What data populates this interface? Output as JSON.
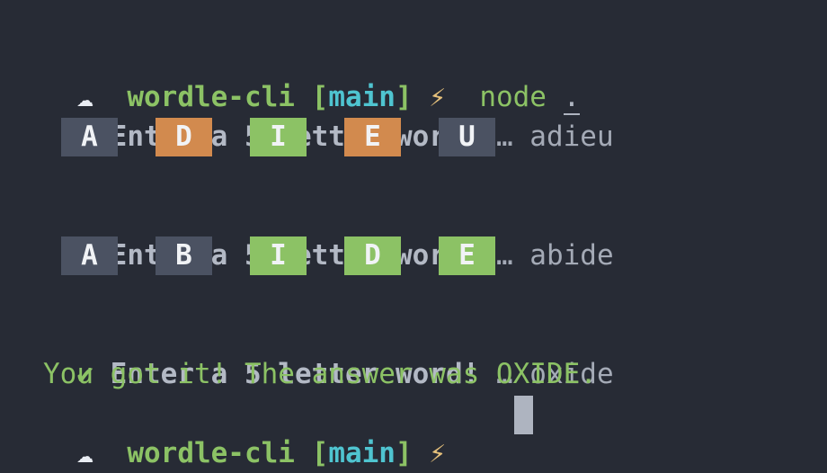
{
  "prompt": {
    "icon": "cloud-icon",
    "cloud_glyph": "☁",
    "dir": "wordle-cli",
    "branch_open": "[",
    "branch": "main",
    "branch_close": "]",
    "bolt_glyph": "⚡",
    "command": "node",
    "command_arg": "."
  },
  "rounds": [
    {
      "check": "✔",
      "question": "Enter a 5 letter word!",
      "ellipsis": "…",
      "answer": "adieu",
      "tiles": [
        {
          "letter": "A",
          "state": "absent"
        },
        {
          "letter": "D",
          "state": "present"
        },
        {
          "letter": "I",
          "state": "correct"
        },
        {
          "letter": "E",
          "state": "present"
        },
        {
          "letter": "U",
          "state": "absent"
        }
      ]
    },
    {
      "check": "✔",
      "question": "Enter a 5 letter word!",
      "ellipsis": "…",
      "answer": "abide",
      "tiles": [
        {
          "letter": "A",
          "state": "absent"
        },
        {
          "letter": "B",
          "state": "absent"
        },
        {
          "letter": "I",
          "state": "correct"
        },
        {
          "letter": "D",
          "state": "correct"
        },
        {
          "letter": "E",
          "state": "correct"
        }
      ]
    },
    {
      "check": "✔",
      "question": "Enter a 5 letter word!",
      "ellipsis": "…",
      "answer": "oxide"
    }
  ],
  "result": "You got it! The answer was OXIDE.",
  "colors": {
    "absent": "#4b5262",
    "present": "#d28a4e",
    "correct": "#8cc265",
    "background": "#272b35"
  }
}
